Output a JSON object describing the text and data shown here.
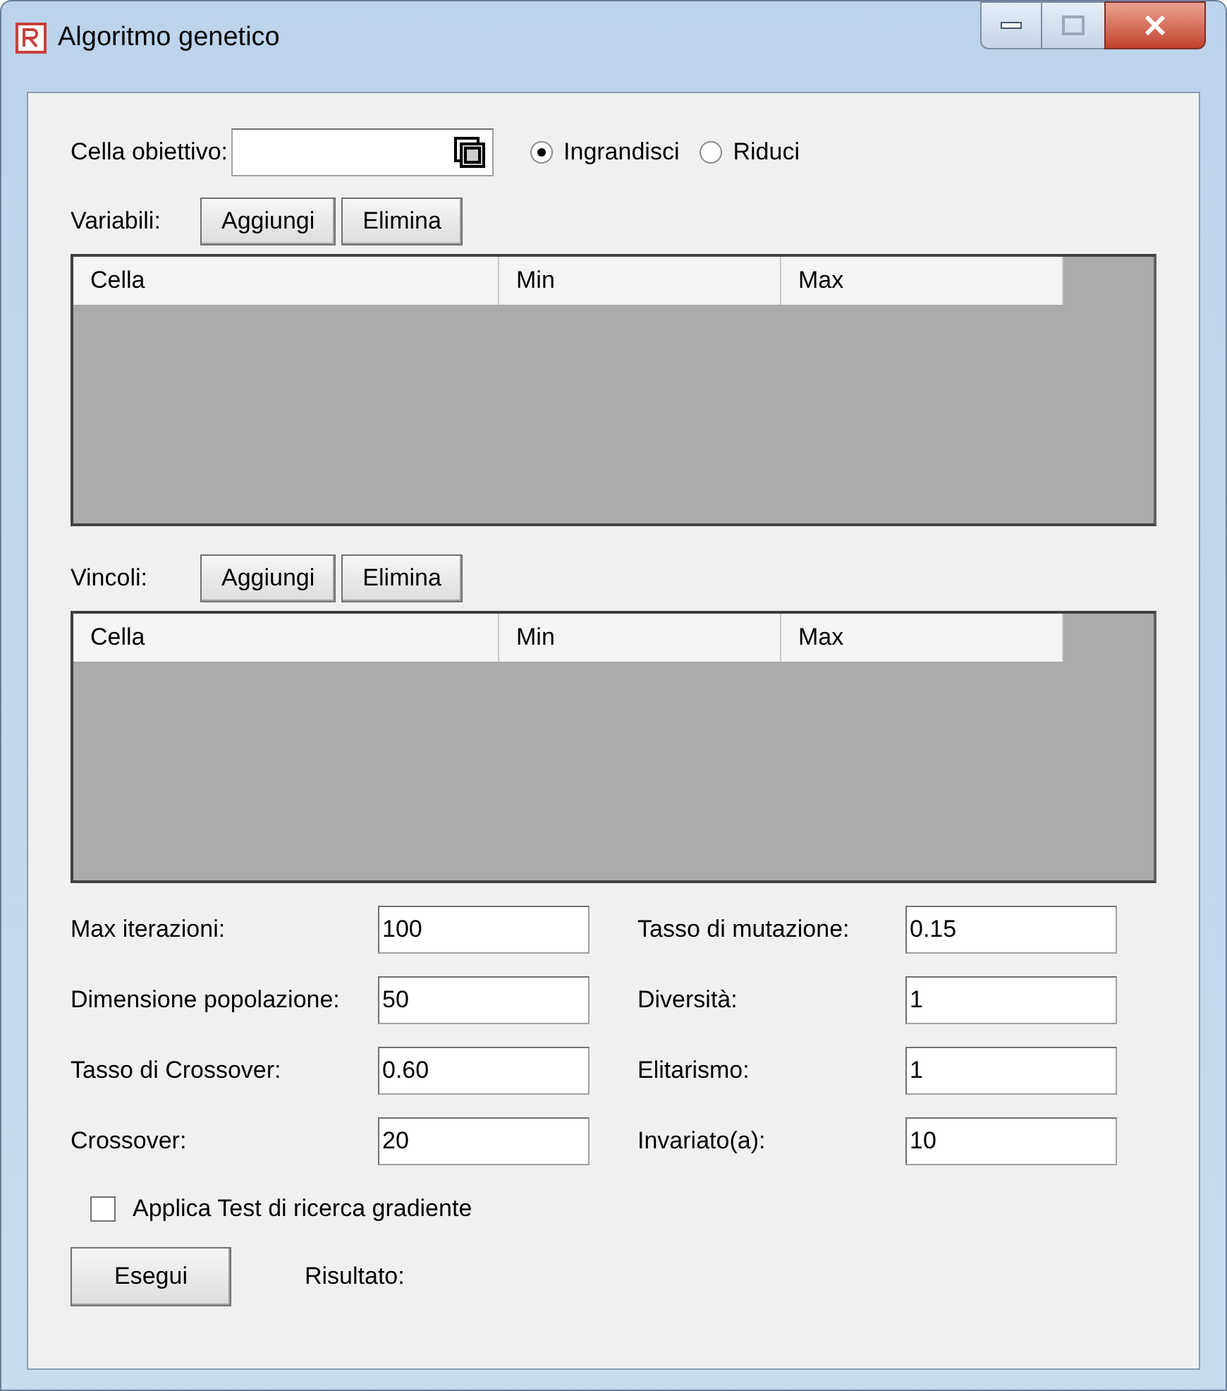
{
  "window": {
    "title": "Algoritmo genetico"
  },
  "target": {
    "label": "Cella obiettivo:"
  },
  "goal": [
    {
      "label": "Ingrandisci",
      "selected": true
    },
    {
      "label": "Riduci",
      "selected": false
    }
  ],
  "variables": {
    "label": "Variabili:",
    "buttons": [
      "Aggiungi",
      "Elimina"
    ],
    "columns": [
      "Cella",
      "Min",
      "Max"
    ]
  },
  "constraints": {
    "label": "Vincoli:",
    "buttons": [
      "Aggiungi",
      "Elimina"
    ],
    "columns": [
      "Cella",
      "Min",
      "Max"
    ]
  },
  "params_left": [
    {
      "label": "Max iterazioni:",
      "value": "100"
    },
    {
      "label": "Dimensione popolazione:",
      "value": "50"
    },
    {
      "label": "Tasso di Crossover:",
      "value": "0.60"
    },
    {
      "label": "Crossover:",
      "value": "20"
    }
  ],
  "params_right": [
    {
      "label": "Tasso di mutazione:",
      "value": "0.15"
    },
    {
      "label": "Diversità:",
      "value": "1"
    },
    {
      "label": "Elitarismo:",
      "value": "1"
    },
    {
      "label": "Invariato(a):",
      "value": "10"
    }
  ],
  "gradient_test": {
    "label": "Applica Test di ricerca gradiente",
    "checked": false
  },
  "run_button": "Esegui",
  "result_label": "Risultato:"
}
